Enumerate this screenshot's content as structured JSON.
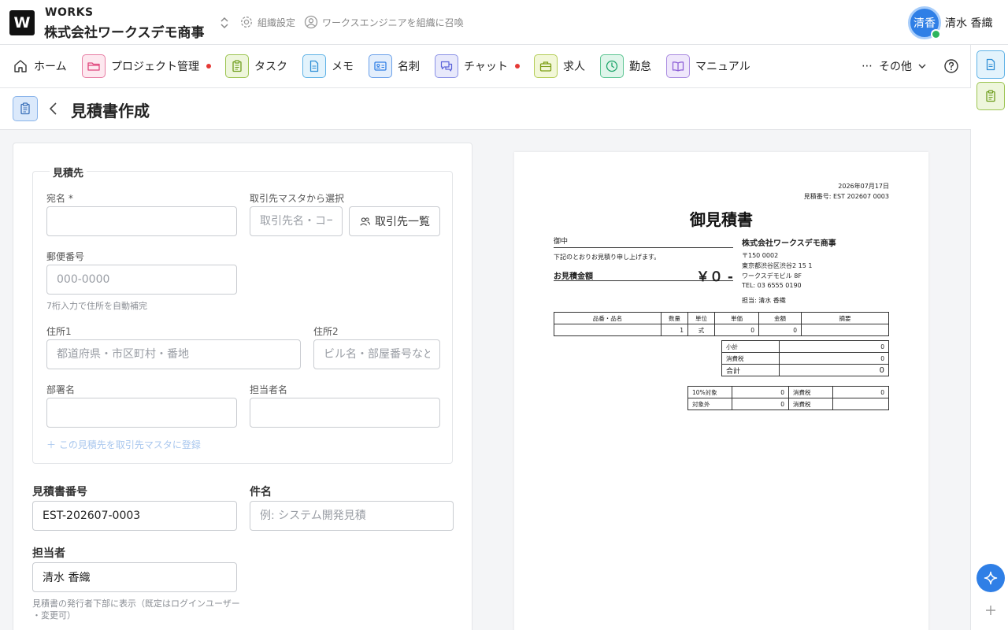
{
  "header": {
    "logo_letter": "W",
    "brand": "WORKS",
    "company": "株式会社ワークスデモ商事",
    "org_settings": "組織設定",
    "invite": "ワークスエンジニアを組織に召喚",
    "avatar_initials": "清香",
    "user_name": "清水 香織"
  },
  "nav": {
    "items": [
      {
        "label": "ホーム",
        "icon": "home-icon"
      },
      {
        "label": "プロジェクト管理",
        "icon": "folder-icon",
        "color": "#e0467c"
      },
      {
        "label": "タスク",
        "icon": "clipboard-icon",
        "color": "#7cad2b"
      },
      {
        "label": "メモ",
        "icon": "document-icon",
        "color": "#2f8fd6"
      },
      {
        "label": "名刺",
        "icon": "business-card-icon",
        "color": "#2f7fe6"
      },
      {
        "label": "チャット",
        "icon": "chat-icon",
        "color": "#5b63d9"
      },
      {
        "label": "求人",
        "icon": "briefcase-icon",
        "color": "#8cab1f"
      },
      {
        "label": "勤怠",
        "icon": "clock-icon",
        "color": "#1ea56b"
      },
      {
        "label": "マニュアル",
        "icon": "book-icon",
        "color": "#8a5bd6"
      }
    ],
    "more_label": "その他"
  },
  "page": {
    "title": "見積書作成"
  },
  "form": {
    "recipient_legend": "見積先",
    "name_label": "宛名 *",
    "name_value": "",
    "master_label": "取引先マスタから選択",
    "master_placeholder": "取引先名・コード",
    "client_list_button": "取引先一覧",
    "postal_label": "郵便番号",
    "postal_placeholder": "000-0000",
    "postal_hint": "7桁入力で住所を自動補完",
    "address1_label": "住所1",
    "address1_placeholder": "都道府県・市区町村・番地",
    "address2_label": "住所2",
    "address2_placeholder": "ビル名・部屋番号など",
    "dept_label": "部署名",
    "dept_value": "",
    "contact_label": "担当者名",
    "contact_value": "",
    "register_link": "＋ この見積先を取引先マスタに登録",
    "estimate_number_label": "見積書番号",
    "estimate_number_value": "EST-202607-0003",
    "subject_label": "件名",
    "subject_placeholder": "例: システム開発見積",
    "assignee_label": "担当者",
    "assignee_value": "清水 香織",
    "assignee_hint_1": "見積書の発行者下部に表示（既定はログインユーザー",
    "assignee_hint_2": "・変更可）"
  },
  "preview": {
    "date": "2026年07月17日",
    "number": "見積番号: EST 202607 0003",
    "title": "御見積書",
    "client": "御中",
    "lead": "下記のとおりお見積り申し上げます。",
    "amount_label": "お見積金額",
    "amount_value": "￥０ -",
    "company": "株式会社ワークスデモ商事",
    "postal": "〒150 0002",
    "address": "東京都渋谷区渋谷2 15 1",
    "building": "ワークスデモビル 8F",
    "tel": "TEL: 03 6555 0190",
    "person": "担当: 清水 香織",
    "table_headers": [
      "品番・品名",
      "数量",
      "単位",
      "単価",
      "金額",
      "摘要"
    ],
    "row": {
      "qty": "1",
      "unit": "式",
      "price": "0",
      "amount": "0"
    },
    "subtotal_label": "小計",
    "subtotal": "0",
    "tax_label": "消費税",
    "tax": "0",
    "total_label": "合計",
    "total": "0",
    "tax10_label": "10%対象",
    "tax10_amount": "0",
    "tax10_tax_label": "消費税",
    "tax10_tax": "0",
    "exempt_label": "対象外",
    "exempt_amount": "0",
    "exempt_tax_label": "消費税",
    "exempt_tax": ""
  }
}
